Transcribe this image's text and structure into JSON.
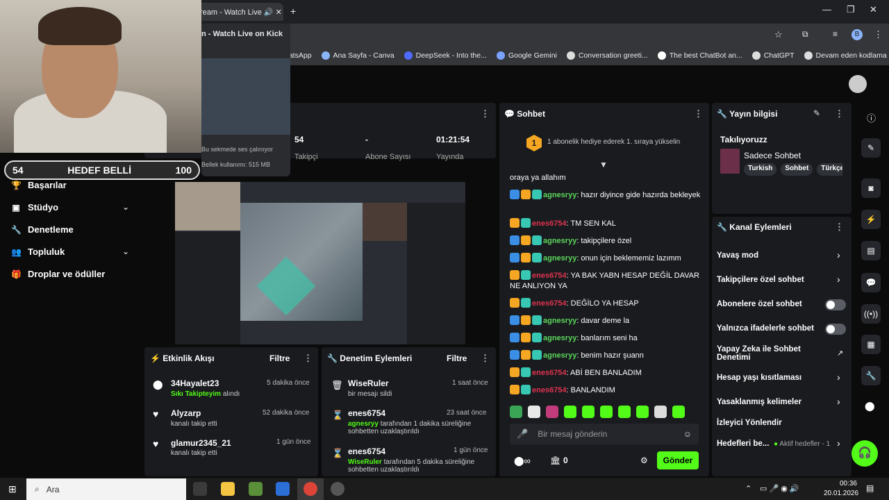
{
  "browser": {
    "tab_title": "ream - Watch Live",
    "hover_title": "n - Watch Live on Kick",
    "hover_audio": "Bu sekmede ses çalınıyor",
    "hover_memory": "Bellek kullanımı: 515 MB",
    "bookmarks": [
      "hatsApp",
      "Ana Sayfa - Canva",
      "DeepSeek - Into the...",
      "Google Gemini",
      "Conversation greeti...",
      "The best ChatBot an...",
      "ChatGPT",
      "Devam eden kodlama"
    ],
    "avatar_letter": "B"
  },
  "goal": {
    "current": "54",
    "label": "HEDEF BELLİ",
    "target": "100",
    "progress": 0.54
  },
  "stats": [
    {
      "value": "54",
      "label": "Takipçi"
    },
    {
      "value": "-",
      "label": "Abone Sayısı"
    },
    {
      "value": "01:21:54",
      "label": "Yayında"
    }
  ],
  "nav": {
    "items": [
      {
        "label": "Başarılar",
        "icon": "trophy-icon",
        "chev": false
      },
      {
        "label": "Stüdyo",
        "icon": "studio-icon",
        "chev": true
      },
      {
        "label": "Denetleme",
        "icon": "wrench-icon",
        "chev": false
      },
      {
        "label": "Topluluk",
        "icon": "community-icon",
        "chev": true
      },
      {
        "label": "Droplar ve ödüller",
        "icon": "gift-icon",
        "chev": false
      }
    ]
  },
  "chat": {
    "title": "Sohbet",
    "gift_banner": "1 abonelik hediye ederek 1. sıraya yükselin",
    "gift_rank": "1",
    "messages": [
      {
        "user": "",
        "text": "oraya ya allahım",
        "color": "none",
        "badges": "none"
      },
      {
        "user": "agnesryy",
        "text": ": hazır diyince gide hazırda bekleyek",
        "color": "green",
        "badges": "three"
      },
      {
        "user": "enes6754",
        "text": ": TM SEN KAL",
        "color": "red",
        "badges": "two"
      },
      {
        "user": "agnesryy",
        "text": ": takipçilere özel",
        "color": "green",
        "badges": "three"
      },
      {
        "user": "agnesryy",
        "text": ": onun için beklememiz lazımm",
        "color": "green",
        "badges": "three"
      },
      {
        "user": "enes6754",
        "text": ": YA BAK YABN HESAP DEĞİL DAVAR NE ANLIYON YA",
        "color": "red",
        "badges": "two"
      },
      {
        "user": "enes6754",
        "text": ": DEĞİLO YA HESAP",
        "color": "red",
        "badges": "two"
      },
      {
        "user": "agnesryy",
        "text": ": davar deme la",
        "color": "green",
        "badges": "three"
      },
      {
        "user": "agnesryy",
        "text": ": banlarım seni ha",
        "color": "green",
        "badges": "three"
      },
      {
        "user": "agnesryy",
        "text": ": benim hazır şuann",
        "color": "green",
        "badges": "three"
      },
      {
        "user": "enes6754",
        "text": ": ABİ BEN BANLADIM",
        "color": "red",
        "badges": "two"
      },
      {
        "user": "enes6754",
        "text": ": BANLANDIM",
        "color": "red",
        "badges": "two"
      }
    ],
    "input_placeholder": "Bir mesaj gönderin",
    "points": "0",
    "send_label": "Gönder"
  },
  "stream_info": {
    "title": "Yayın bilgisi",
    "stream_title": "Takılıyoruzz",
    "category": "Sadece Sohbet",
    "tags": [
      "Turkish",
      "Sohbet",
      "Türkçe"
    ]
  },
  "channel_actions": {
    "title": "Kanal Eylemleri",
    "items": [
      {
        "label": "Yavaş mod",
        "type": "chevron"
      },
      {
        "label": "Takipçilere özel sohbet",
        "type": "chevron"
      },
      {
        "label": "Abonelere özel sohbet",
        "type": "toggle"
      },
      {
        "label": "Yalnızca ifadelerle sohbet",
        "type": "toggle"
      },
      {
        "label": "Yapay Zeka ile Sohbet Denetimi",
        "type": "external"
      },
      {
        "label": "Hesap yaşı kısıtlaması",
        "type": "chevron"
      },
      {
        "label": "Yasaklanmış kelimeler",
        "type": "chevron"
      },
      {
        "label": "İzleyici Yönlendir",
        "type": "none"
      },
      {
        "label": "Hedefleri be...",
        "type": "chevron",
        "extra": "Aktif hedefler - 1"
      }
    ]
  },
  "activity": {
    "title": "Etkinlik Akışı",
    "filter": "Filtre",
    "items": [
      {
        "name": "34Hayalet23",
        "time": "5 dakika önce",
        "sub_bold": "Sıkı Takipteyim",
        "sub": " alındı",
        "icon": "bits-icon"
      },
      {
        "name": "Alyzarp",
        "time": "52 dakika önce",
        "sub_bold": "",
        "sub": "kanalı takip etti",
        "icon": "heart-icon"
      },
      {
        "name": "glamur2345_21",
        "time": "1 gün önce",
        "sub_bold": "",
        "sub": "kanalı takip etti",
        "icon": "heart-icon"
      }
    ]
  },
  "moderation": {
    "title": "Denetim Eylemleri",
    "filter": "Filtre",
    "items": [
      {
        "name": "WiseRuler",
        "time": "1 saat önce",
        "sub_bold": "",
        "sub": "bir mesajı sildi",
        "icon": "trash-icon"
      },
      {
        "name": "enes6754",
        "time": "23 saat önce",
        "sub_bold": "agnesryy",
        "sub": " tarafından 1 dakika süreliğine sohbetten uzaklaştırıldı",
        "icon": "hourglass-icon"
      },
      {
        "name": "enes6754",
        "time": "1 gün önce",
        "sub_bold": "WiseRuler",
        "sub": " tarafından 5 dakika süreliğine sohbetten uzaklaştırıldı",
        "icon": "hourglass-icon"
      }
    ]
  },
  "taskbar": {
    "search": "Ara",
    "time": "00:36",
    "date": "20.01.2026"
  },
  "colors": {
    "kick_green": "#53fc18",
    "panel": "#191b1f",
    "bg": "#0b0b0c"
  }
}
